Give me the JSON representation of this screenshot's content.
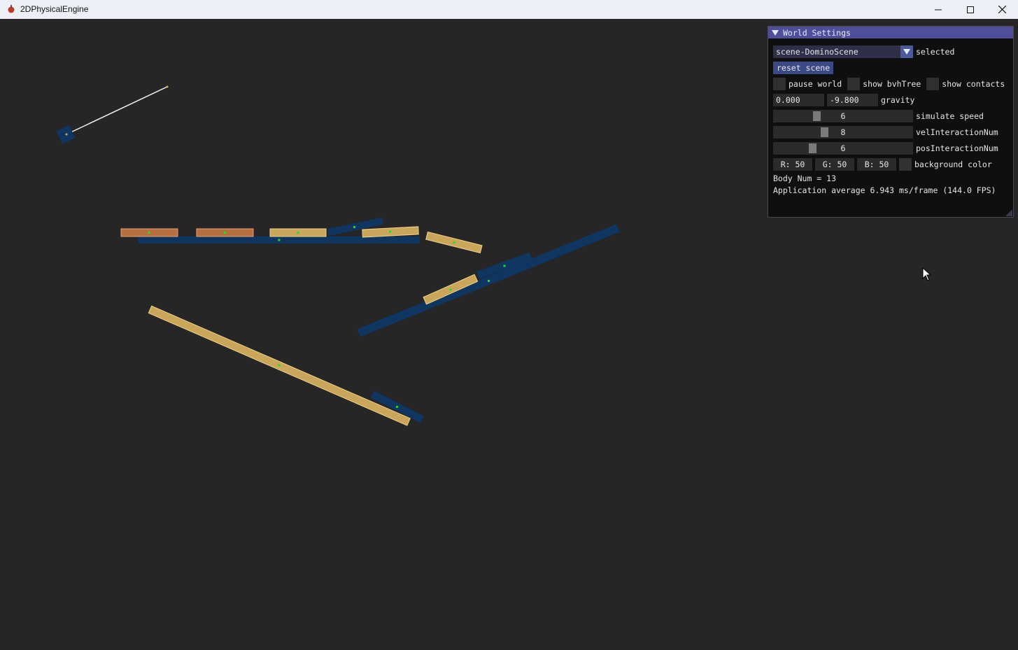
{
  "window": {
    "title": "2DPhysicalEngine",
    "icons": {
      "app": "engine-app-icon",
      "minimize": "minimize-icon",
      "maximize": "maximize-icon",
      "close": "close-icon"
    }
  },
  "panel": {
    "title": "World Settings",
    "scene_select": {
      "value": "scene-DominoScene",
      "label": "selected"
    },
    "reset_label": "reset scene",
    "checkboxes": [
      {
        "label": "pause world",
        "checked": false
      },
      {
        "label": "show bvhTree",
        "checked": false
      },
      {
        "label": "show contacts",
        "checked": false
      }
    ],
    "gravity": {
      "x": "0.000",
      "y": "-9.800",
      "label": "gravity"
    },
    "sliders": [
      {
        "value": "6",
        "label": "simulate speed",
        "fraction": 0.3
      },
      {
        "value": "8",
        "label": "velInteractionNum",
        "fraction": 0.36
      },
      {
        "value": "6",
        "label": "posInteractionNum",
        "fraction": 0.27
      }
    ],
    "background_color": {
      "r": "R: 50",
      "g": "G: 50",
      "b": "B: 50",
      "label": "background color",
      "swatch": "#323232"
    },
    "body_num": "Body Num = 13",
    "fps": "Application average 6.943 ms/frame (144.0 FPS)"
  },
  "colors": {
    "background": "#262626",
    "static_body": "#0f3561",
    "domino_yellow": "#c9a65a",
    "domino_orange": "#b86f3f",
    "center_dot": "#22dd22",
    "panel_header": "#4e4e9a"
  }
}
